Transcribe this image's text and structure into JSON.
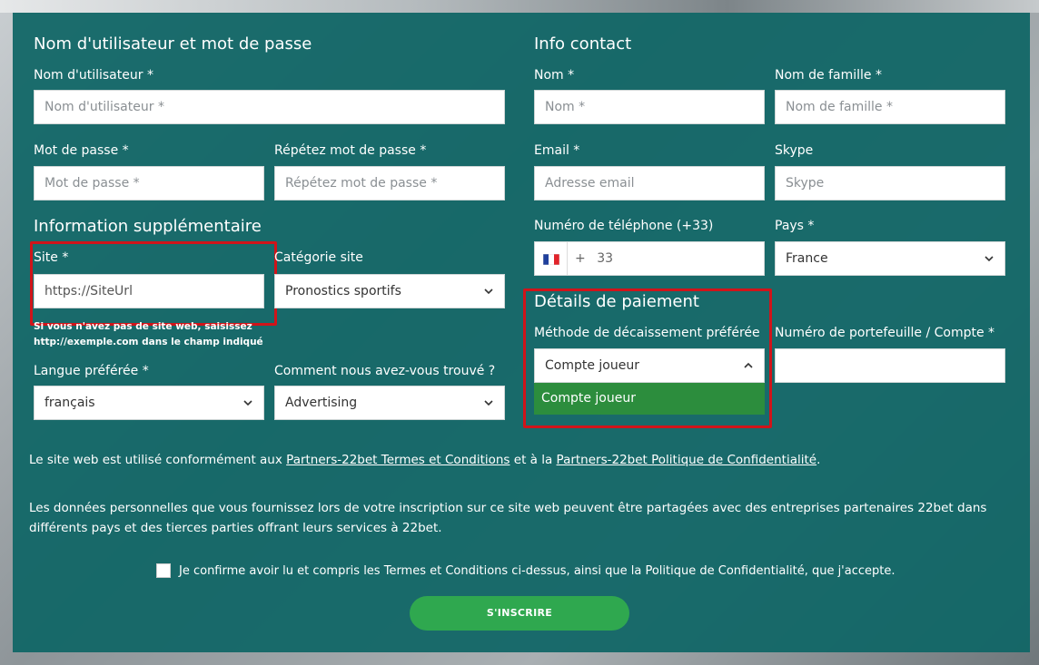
{
  "account": {
    "title": "Nom d'utilisateur et mot de passe",
    "username_label": "Nom d'utilisateur *",
    "username_placeholder": "Nom d'utilisateur *",
    "password_label": "Mot de passe *",
    "password_placeholder": "Mot de passe *",
    "repeat_label": "Répétez mot de passe *",
    "repeat_placeholder": "Répétez mot de passe *"
  },
  "extra": {
    "title": "Information supplémentaire",
    "site_label": "Site *",
    "site_value": "https://SiteUrl",
    "category_label": "Catégorie site",
    "category_value": "Pronostics sportifs",
    "site_note_line1": "Si vous n'avez pas de site web, saisissez",
    "site_note_line2": "http://exemple.com dans le champ indiqué",
    "language_label": "Langue préférée *",
    "language_value": "français",
    "source_label": "Comment nous avez-vous trouvé ?",
    "source_value": "Advertising"
  },
  "contact": {
    "title": "Info contact",
    "firstname_label": "Nom *",
    "firstname_placeholder": "Nom *",
    "lastname_label": "Nom de famille *",
    "lastname_placeholder": "Nom de famille *",
    "email_label": "Email *",
    "email_placeholder": "Adresse email",
    "skype_label": "Skype",
    "skype_placeholder": "Skype",
    "phone_label": "Numéro de téléphone (+33)",
    "phone_prefix": "+",
    "phone_code": "33",
    "country_label": "Pays *",
    "country_value": "France"
  },
  "payment": {
    "title": "Détails de paiement",
    "method_label": "Méthode de décaissement préférée",
    "method_value": "Compte joueur",
    "method_options": [
      "Compte joueur"
    ],
    "wallet_label": "Numéro de portefeuille / Compte *",
    "wallet_value": ""
  },
  "legal": {
    "terms_prefix": "Le site web est utilisé conformément aux ",
    "terms_link": "Partners-22bet Termes et Conditions",
    "terms_middle": " et à la ",
    "privacy_link": "Partners-22bet Politique de Confidentialité",
    "terms_suffix": ".",
    "data_text": "Les données personnelles que vous fournissez lors de votre inscription sur ce site web peuvent être partagées avec des entreprises partenaires 22bet dans différents pays et des tierces parties offrant leurs services à 22bet.",
    "consent_text": "Je confirme avoir lu et compris les Termes et Conditions ci-dessus, ainsi que la Politique de Confidentialité, que j'accepte."
  },
  "submit_label": "S'INSCRIRE",
  "colors": {
    "panel": "#106666",
    "button": "#2fa84f",
    "dropdown_option": "#2c8d3d",
    "highlight": "#d0141a"
  },
  "icons": [
    "chevron-down-icon",
    "chevron-up-icon",
    "france-flag-icon"
  ]
}
